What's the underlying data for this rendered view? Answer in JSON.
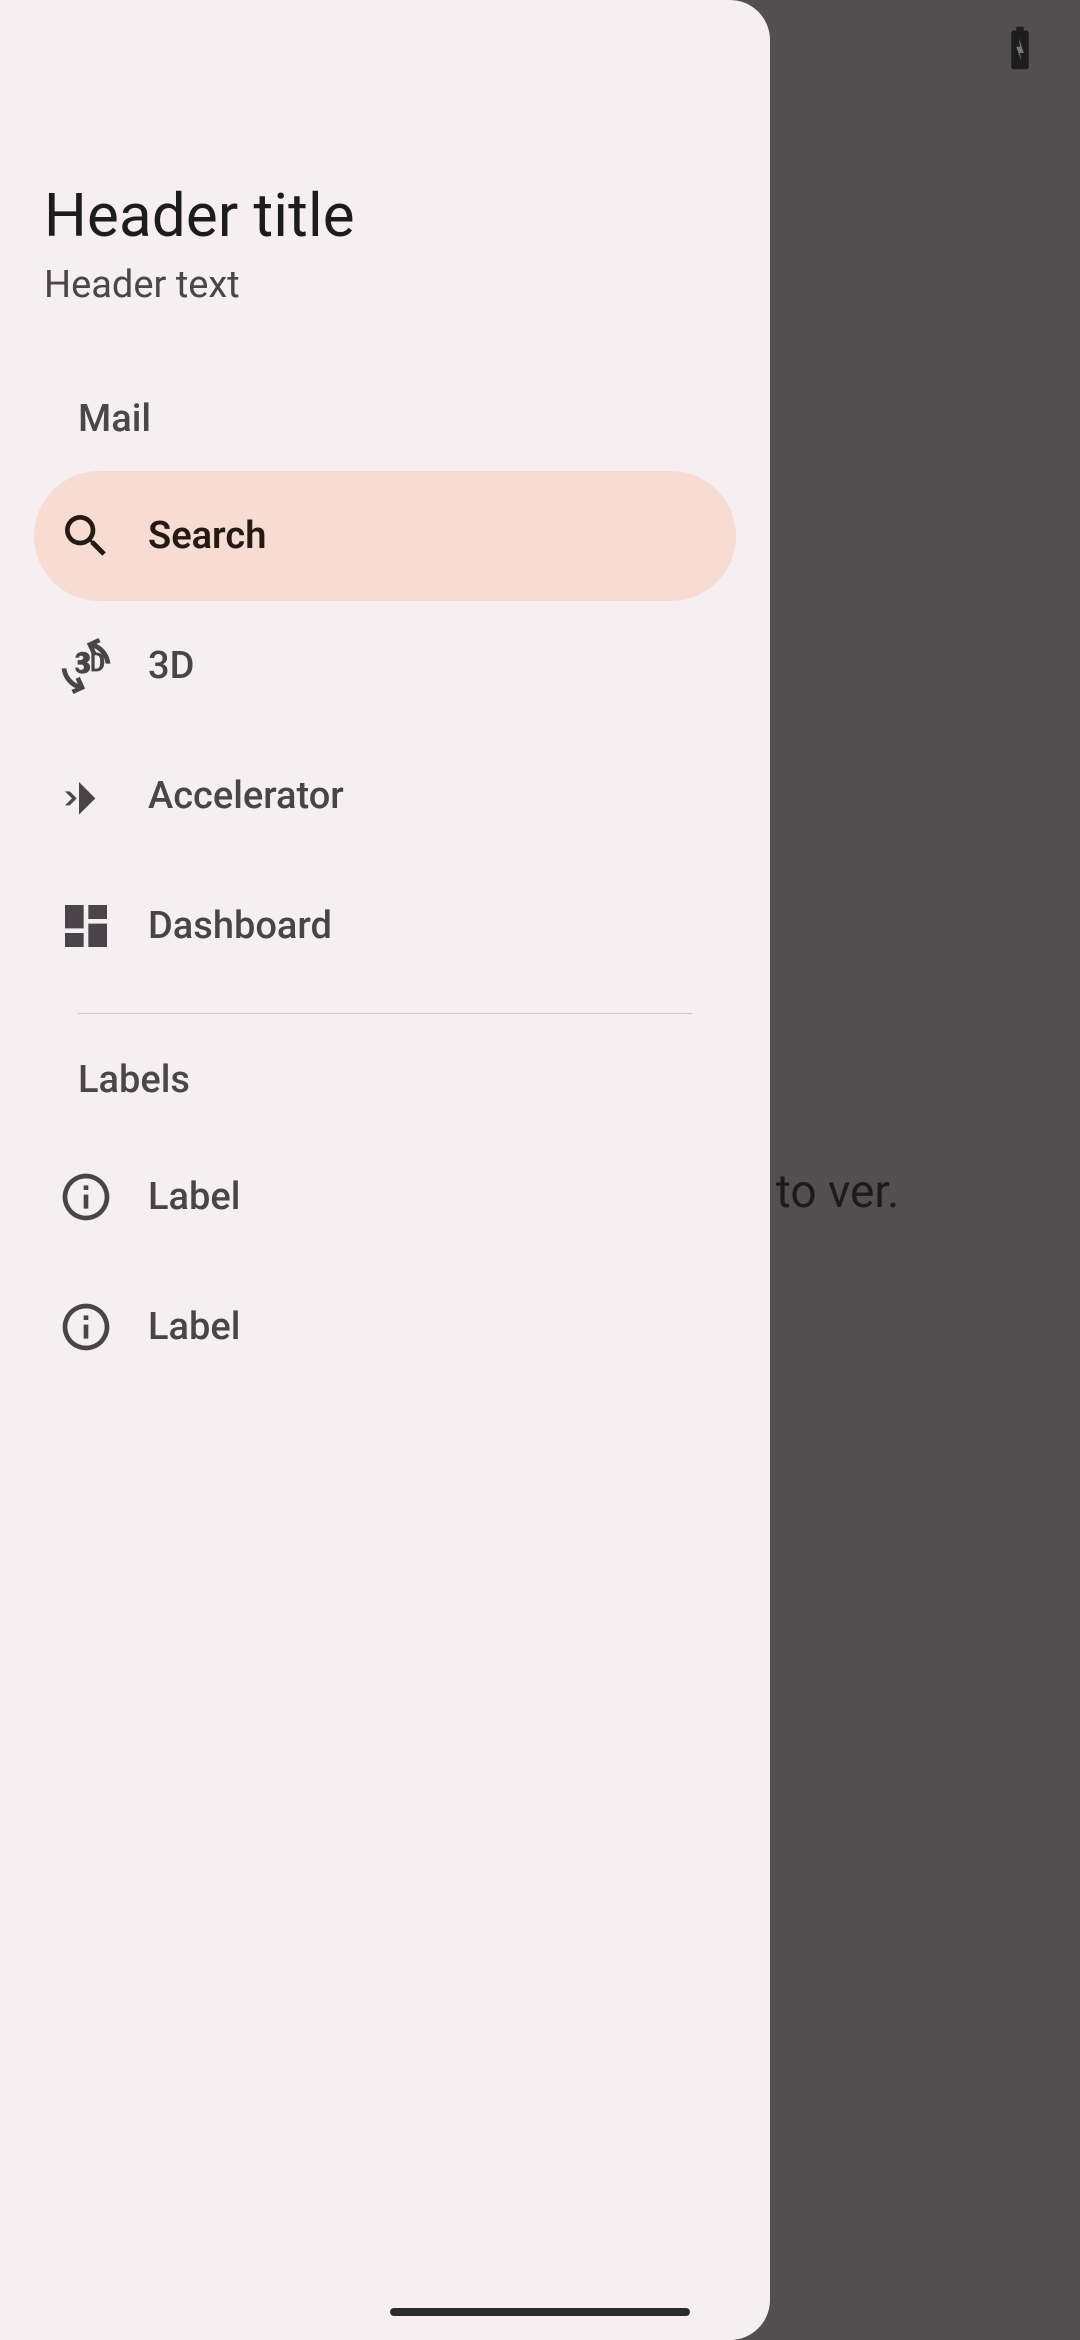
{
  "background_hint": "e to\nver.",
  "drawer": {
    "title": "Header title",
    "subtitle": "Header text",
    "sections": {
      "mail_label": "Mail",
      "labels_label": "Labels"
    },
    "items": {
      "search": {
        "label": "Search",
        "icon": "search-icon",
        "selected": true
      },
      "threed": {
        "label": "3D",
        "icon": "rotation-3d-icon",
        "selected": false
      },
      "accelerator": {
        "label": "Accelerator",
        "icon": "accelerator-icon",
        "selected": false
      },
      "dashboard": {
        "label": "Dashboard",
        "icon": "dashboard-icon",
        "selected": false
      },
      "label1": {
        "label": "Label",
        "icon": "info-icon",
        "selected": false
      },
      "label2": {
        "label": "Label",
        "icon": "info-icon",
        "selected": false
      }
    }
  }
}
